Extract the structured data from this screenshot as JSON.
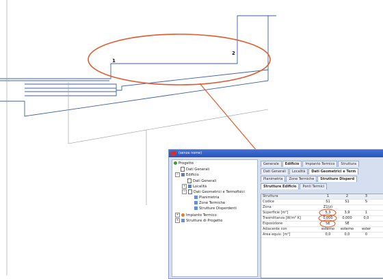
{
  "drawing": {
    "point_1": "1",
    "point_2": "2"
  },
  "window": {
    "title": "(senza nome)"
  },
  "tree": {
    "nodes": [
      {
        "label": "Progetto"
      },
      {
        "label": "Dati Generali"
      },
      {
        "label": "Edificio"
      },
      {
        "label": "Dati Generali"
      },
      {
        "label": "Località"
      },
      {
        "label": "Dati Geometrici e Termofisici"
      },
      {
        "label": "Planimetria"
      },
      {
        "label": "Zone Termiche"
      },
      {
        "label": "Strutture Disperdenti"
      },
      {
        "label": "Impianto Termico"
      },
      {
        "label": "Strutture di Progetto"
      }
    ]
  },
  "tabs": {
    "row1": [
      "Generale",
      "Edificio",
      "Impianto Termico",
      "Struttura"
    ],
    "row2": [
      "Dati Generali",
      "Località",
      "Dati Geometrici e Term"
    ],
    "row3": [
      "Planimetria",
      "Zone Termiche",
      "Strutture Disperd"
    ],
    "row4": [
      "Strutture Edificio",
      "Ponti Termici"
    ]
  },
  "grid": {
    "header": [
      "Struttura",
      "1",
      "2",
      "3"
    ],
    "rows": [
      {
        "label": "Codice",
        "values": [
          "S1",
          "S1",
          "S"
        ]
      },
      {
        "label": "Zona",
        "values": [
          "Z1(z)",
          "",
          ""
        ]
      },
      {
        "label": "Superficie [m²]",
        "values": [
          "5,3",
          "3,9",
          "1"
        ]
      },
      {
        "label": "Trasmittanza [W/m² K]",
        "values": [
          "0,000",
          "0,000",
          "0,0"
        ]
      },
      {
        "label": "Esposizione",
        "values": [
          "SE",
          "SE",
          ""
        ]
      },
      {
        "label": "Adiacente con",
        "values": [
          "esterno",
          "esterno",
          "ester"
        ]
      },
      {
        "label": "Area equiv. [m²]",
        "values": [
          "0,0",
          "0,0",
          "0"
        ]
      }
    ]
  },
  "colors": {
    "highlight": "#e05a2b",
    "plan_line": "#3a5ea8"
  }
}
